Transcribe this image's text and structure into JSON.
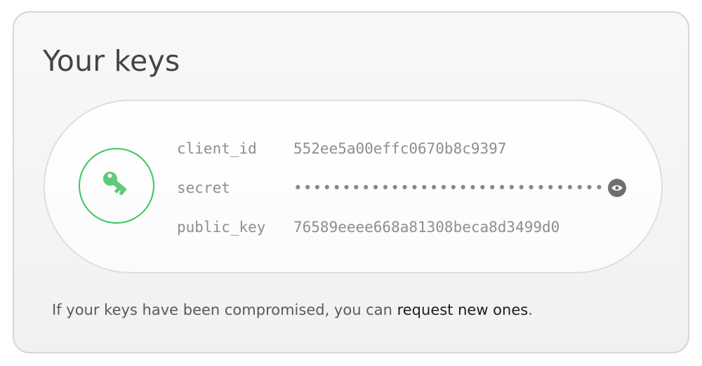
{
  "panel": {
    "title": "Your keys",
    "key_icon": "key-icon",
    "fields": [
      {
        "label": "client_id",
        "value": "552ee5a00effc0670b8c9397"
      },
      {
        "label": "secret",
        "value": "••••••••••••••••••••••••••••••••",
        "masked": true,
        "reveal_icon": "eye-icon"
      },
      {
        "label": "public_key",
        "value": "76589eeee668a81308beca8d3499d0"
      }
    ],
    "footer": {
      "text": "If your keys have been compromised, you can ",
      "link_text": "request new ones",
      "suffix": "."
    },
    "colors": {
      "accent_green": "#3cc45a",
      "key_icon": "#5fca7a"
    }
  }
}
